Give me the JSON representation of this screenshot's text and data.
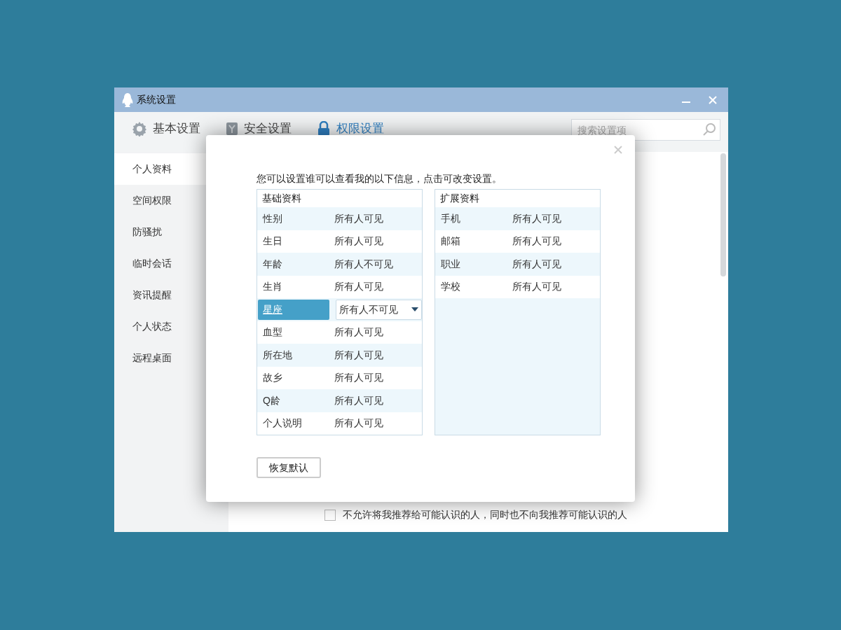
{
  "window": {
    "title": "系统设置"
  },
  "tabs": [
    {
      "label": "基本设置",
      "selected": false
    },
    {
      "label": "安全设置",
      "selected": false
    },
    {
      "label": "权限设置",
      "selected": true
    }
  ],
  "search": {
    "placeholder": "搜索设置项"
  },
  "sidebar": {
    "items": [
      {
        "label": "个人资料",
        "selected": true
      },
      {
        "label": "空间权限",
        "selected": false
      },
      {
        "label": "防骚扰",
        "selected": false
      },
      {
        "label": "临时会话",
        "selected": false
      },
      {
        "label": "资讯提醒",
        "selected": false
      },
      {
        "label": "个人状态",
        "selected": false
      },
      {
        "label": "远程桌面",
        "selected": false
      }
    ]
  },
  "content": {
    "recommend_checkbox": {
      "label": "不允许将我推荐给可能认识的人，同时也不向我推荐可能认识的人",
      "checked": false
    }
  },
  "dialog": {
    "intro": "您可以设置谁可以查看我的以下信息，点击可改变设置。",
    "tables": [
      {
        "title": "基础资料",
        "rows": [
          {
            "field": "性别",
            "visibility": "所有人可见",
            "selected": false
          },
          {
            "field": "生日",
            "visibility": "所有人可见",
            "selected": false
          },
          {
            "field": "年龄",
            "visibility": "所有人不可见",
            "selected": false
          },
          {
            "field": "生肖",
            "visibility": "所有人可见",
            "selected": false
          },
          {
            "field": "星座",
            "visibility": "所有人不可见",
            "selected": true
          },
          {
            "field": "血型",
            "visibility": "所有人可见",
            "selected": false
          },
          {
            "field": "所在地",
            "visibility": "所有人可见",
            "selected": false
          },
          {
            "field": "故乡",
            "visibility": "所有人可见",
            "selected": false
          },
          {
            "field": "Q龄",
            "visibility": "所有人可见",
            "selected": false
          },
          {
            "field": "个人说明",
            "visibility": "所有人可见",
            "selected": false
          }
        ]
      },
      {
        "title": "扩展资料",
        "rows": [
          {
            "field": "手机",
            "visibility": "所有人可见",
            "selected": false
          },
          {
            "field": "邮箱",
            "visibility": "所有人可见",
            "selected": false
          },
          {
            "field": "职业",
            "visibility": "所有人可见",
            "selected": false
          },
          {
            "field": "学校",
            "visibility": "所有人可见",
            "selected": false
          }
        ]
      }
    ],
    "buttons": [
      "恢复默认"
    ]
  }
}
